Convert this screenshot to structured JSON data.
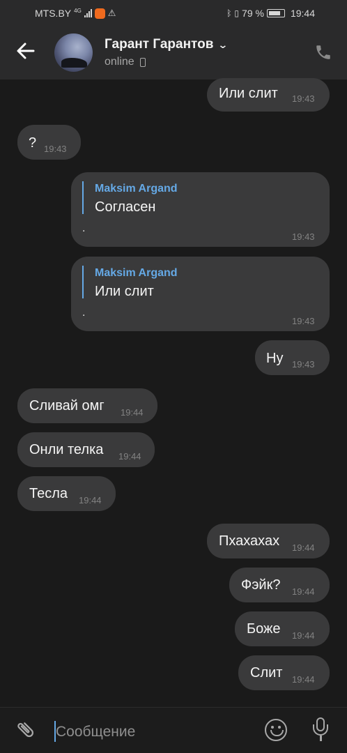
{
  "status_bar": {
    "carrier": "MTS.BY",
    "network": "4G",
    "battery": "79 %",
    "time": "19:44",
    "battery_level": 0.79
  },
  "header": {
    "contact_name": "Гарант Гарантов",
    "status": "online"
  },
  "messages": [
    {
      "side": "out",
      "text": "Или слит",
      "time": "19:43"
    },
    {
      "side": "in",
      "text": "?",
      "time": "19:43"
    },
    {
      "side": "out",
      "reply_to_name": "Maksim Argand",
      "reply_to_text": "Согласен",
      "text": ".",
      "time": "19:43"
    },
    {
      "side": "out",
      "reply_to_name": "Maksim Argand",
      "reply_to_text": "Или слит",
      "text": ".",
      "time": "19:43"
    },
    {
      "side": "out",
      "text": "Ну",
      "time": "19:43"
    },
    {
      "side": "in",
      "text": "Сливай омг",
      "time": "19:44"
    },
    {
      "side": "in",
      "text": "Онли телка",
      "time": "19:44"
    },
    {
      "side": "in",
      "text": "Тесла",
      "time": "19:44"
    },
    {
      "side": "out",
      "text": "Пхахахах",
      "time": "19:44"
    },
    {
      "side": "out",
      "text": "Фэйк?",
      "time": "19:44"
    },
    {
      "side": "out",
      "text": "Боже",
      "time": "19:44"
    },
    {
      "side": "out",
      "text": "Слит",
      "time": "19:44"
    }
  ],
  "composer": {
    "placeholder": "Сообщение",
    "value": ""
  },
  "colors": {
    "background": "#1a1a1a",
    "bar": "#2a2a2b",
    "bubble": "#3a3a3b",
    "accent": "#65a9e6"
  },
  "icons": [
    "back-arrow-icon",
    "chevron-down-icon",
    "mobile-device-icon",
    "phone-call-icon",
    "paperclip-icon",
    "emoji-icon",
    "microphone-icon"
  ]
}
